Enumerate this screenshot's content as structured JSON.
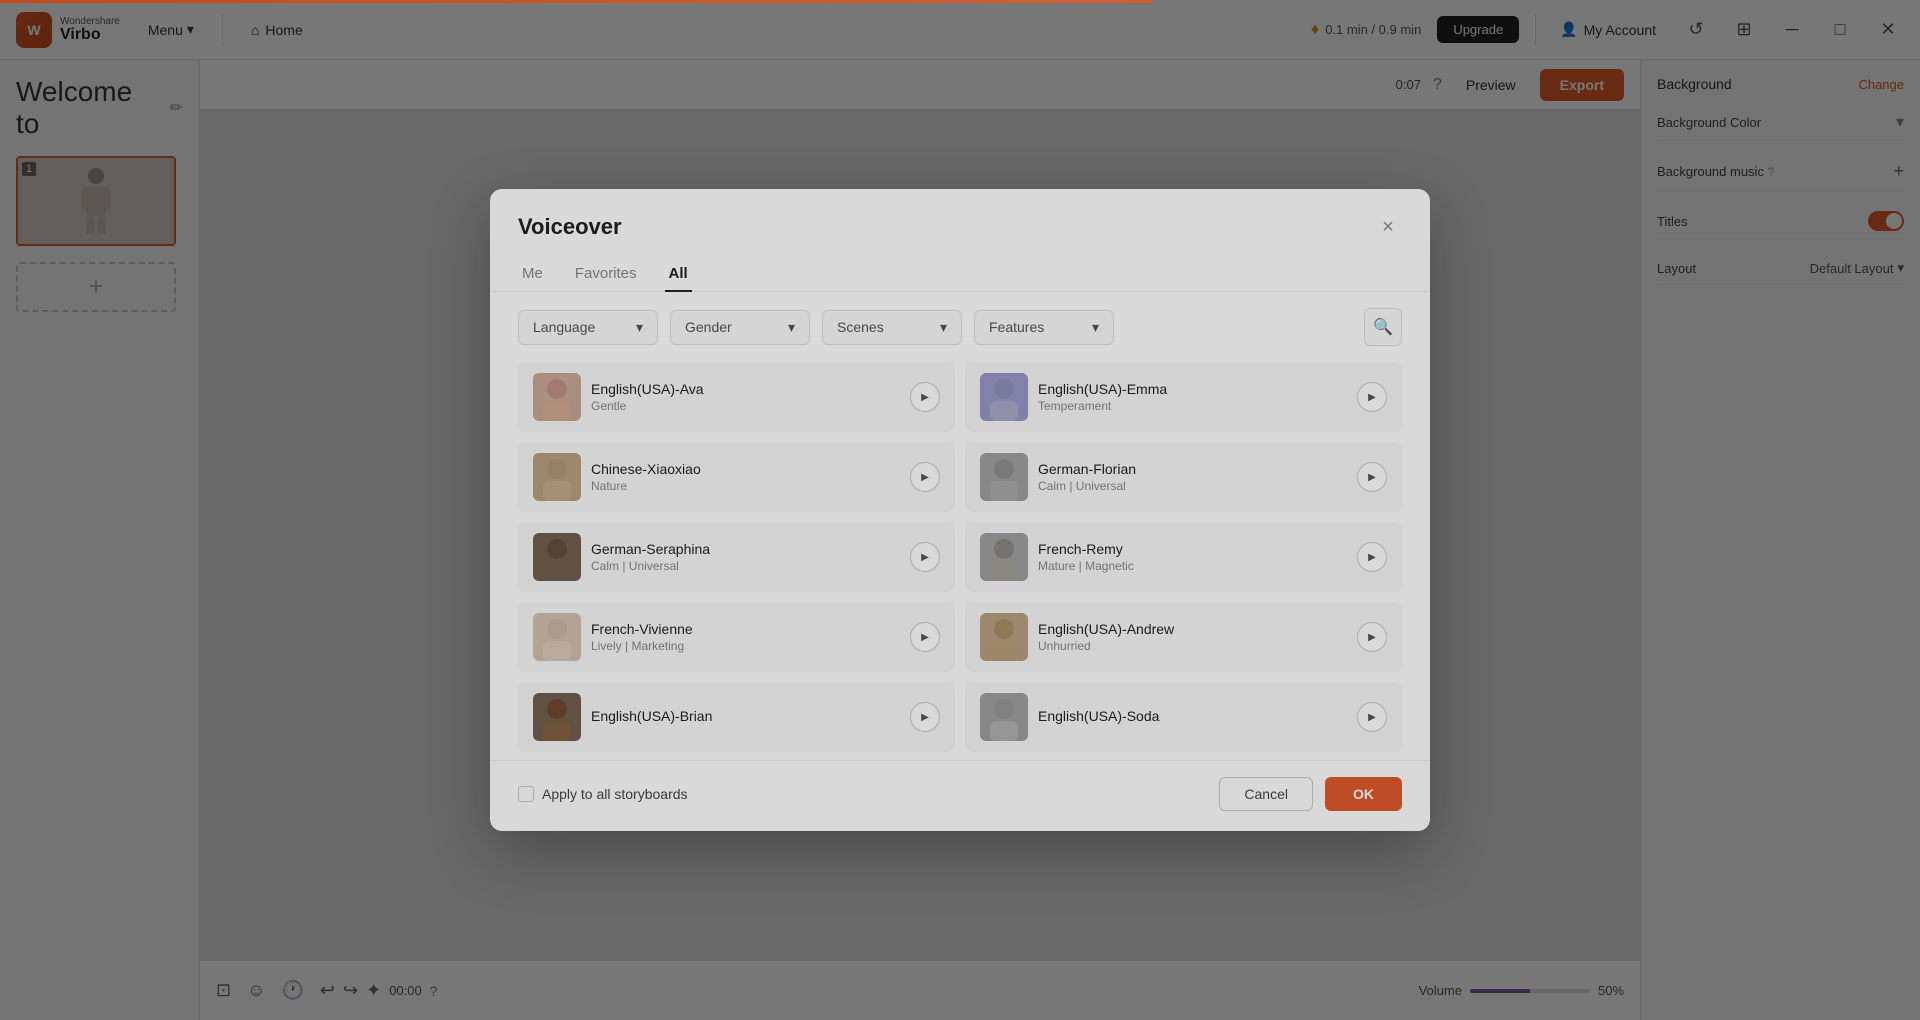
{
  "app": {
    "brand_top": "Wondershare",
    "brand_bottom": "Virbo",
    "menu_label": "Menu",
    "home_label": "Home",
    "credit_text": "0.1 min / 0.9 min",
    "upgrade_label": "Upgrade",
    "account_label": "My Account",
    "preview_label": "Preview",
    "export_label": "Export",
    "time_display": "0:07"
  },
  "left_panel": {
    "welcome_text": "Welcome to",
    "slide_number": "1"
  },
  "bottom_toolbar": {
    "timecode": "00:00",
    "volume_label": "Volume",
    "volume_pct": "50%"
  },
  "right_panel": {
    "background_section": "Background",
    "change_label": "Change",
    "bg_color_label": "Background Color",
    "bg_music_label": "ground music",
    "titles_label": "itles",
    "layout_label": "out",
    "layout_value": "Default Layout"
  },
  "dialog": {
    "title": "Voiceover",
    "close_label": "×",
    "tabs": [
      {
        "id": "me",
        "label": "Me"
      },
      {
        "id": "favorites",
        "label": "Favorites"
      },
      {
        "id": "all",
        "label": "All",
        "active": true
      }
    ],
    "filters": [
      {
        "id": "language",
        "label": "Language"
      },
      {
        "id": "gender",
        "label": "Gender"
      },
      {
        "id": "scenes",
        "label": "Scenes"
      },
      {
        "id": "features",
        "label": "Features"
      }
    ],
    "voices": [
      {
        "id": "ava",
        "name": "English(USA)-Ava",
        "desc": "Gentle",
        "avatar_class": "av-warm"
      },
      {
        "id": "emma",
        "name": "English(USA)-Emma",
        "desc": "Temperament",
        "avatar_class": "av-cool"
      },
      {
        "id": "xiaoxiao",
        "name": "Chinese-Xiaoxiao",
        "desc": "Nature",
        "avatar_class": "av-tan"
      },
      {
        "id": "florian",
        "name": "German-Florian",
        "desc": "Calm | Universal",
        "avatar_class": "av-gray"
      },
      {
        "id": "seraphina",
        "name": "German-Seraphina",
        "desc": "Calm | Universal",
        "avatar_class": "av-dark"
      },
      {
        "id": "remy",
        "name": "French-Remy",
        "desc": "Mature | Magnetic",
        "avatar_class": "av-gray"
      },
      {
        "id": "vivienne",
        "name": "French-Vivienne",
        "desc": "Lively | Marketing",
        "avatar_class": "av-light"
      },
      {
        "id": "andrew",
        "name": "English(USA)-Andrew",
        "desc": "Unhurried",
        "avatar_class": "av-tan"
      },
      {
        "id": "brian",
        "name": "English(USA)-Brian",
        "desc": "",
        "avatar_class": "av-dark"
      },
      {
        "id": "soda",
        "name": "English(USA)-Soda",
        "desc": "",
        "avatar_class": "av-gray"
      }
    ],
    "apply_all_label": "Apply to all storyboards",
    "cancel_label": "Cancel",
    "ok_label": "OK"
  }
}
